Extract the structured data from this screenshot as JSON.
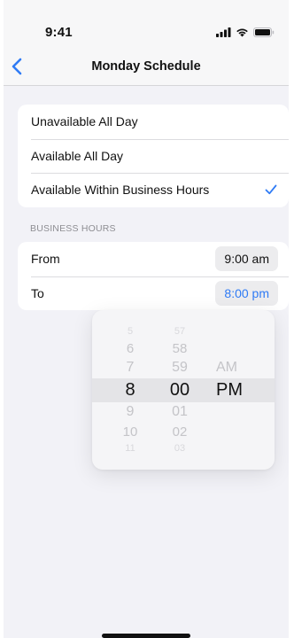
{
  "status": {
    "time": "9:41"
  },
  "nav": {
    "title": "Monday Schedule"
  },
  "availability": {
    "options": [
      {
        "label": "Unavailable All Day",
        "selected": false
      },
      {
        "label": "Available All Day",
        "selected": false
      },
      {
        "label": "Available Within Business Hours",
        "selected": true
      }
    ]
  },
  "business_hours": {
    "header": "BUSINESS HOURS",
    "from": {
      "label": "From",
      "value": "9:00 am"
    },
    "to": {
      "label": "To",
      "value": "8:00 pm"
    }
  },
  "picker": {
    "hours": [
      "5",
      "6",
      "7",
      "8",
      "9",
      "10",
      "11"
    ],
    "minutes": [
      "57",
      "58",
      "59",
      "00",
      "01",
      "02",
      "03"
    ],
    "ampm": [
      "AM",
      "PM"
    ],
    "selected": {
      "hour": "8",
      "minute": "00",
      "ampm": "PM"
    }
  },
  "colors": {
    "accent": "#2f7bf5",
    "background": "#f2f2f7",
    "card": "#ffffff",
    "secondary_text": "#8e8e93"
  },
  "icons": {
    "back": "chevron-left-icon",
    "signal": "cellular-signal-icon",
    "wifi": "wifi-icon",
    "battery": "battery-icon",
    "check": "checkmark-icon"
  }
}
